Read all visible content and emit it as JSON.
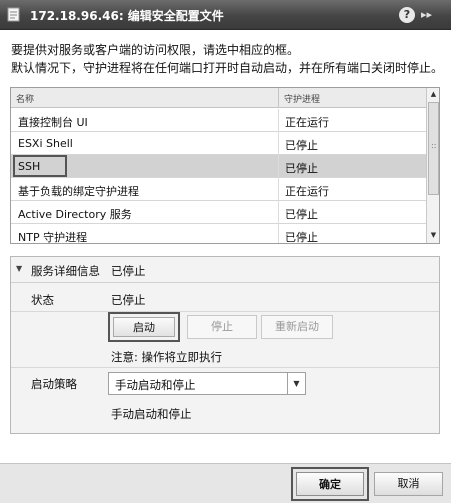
{
  "window": {
    "title": "172.18.96.46: 编辑安全配置文件",
    "help_symbol": "?",
    "expand_symbol": "▸▸"
  },
  "intro": {
    "line1": "要提供对服务或客户端的访问权限，请选中相应的框。",
    "line2": "默认情况下，守护进程将在任何端口打开时自动启动，并在所有端口关闭时停止。"
  },
  "table": {
    "columns": [
      "名称",
      "守护进程"
    ],
    "rows": [
      {
        "name": "直接控制台 UI",
        "status": "正在运行"
      },
      {
        "name": "ESXi Shell",
        "status": "已停止"
      },
      {
        "name": "SSH",
        "status": "已停止",
        "selected": true
      },
      {
        "name": "基于负载的绑定守护进程",
        "status": "正在运行"
      },
      {
        "name": "Active Directory 服务",
        "status": "已停止"
      },
      {
        "name": "NTP 守护进程",
        "status": "已停止"
      }
    ]
  },
  "details": {
    "title": "服务详细信息",
    "summary": "已停止",
    "state_label": "状态",
    "state_value": "已停止",
    "buttons": {
      "start": "启动",
      "stop": "停止",
      "restart": "重新启动"
    },
    "note": "注意: 操作将立即执行",
    "policy_label": "启动策略",
    "policy_value": "手动启动和停止",
    "policy_description": "手动启动和停止"
  },
  "footer": {
    "ok": "确定",
    "cancel": "取消"
  }
}
